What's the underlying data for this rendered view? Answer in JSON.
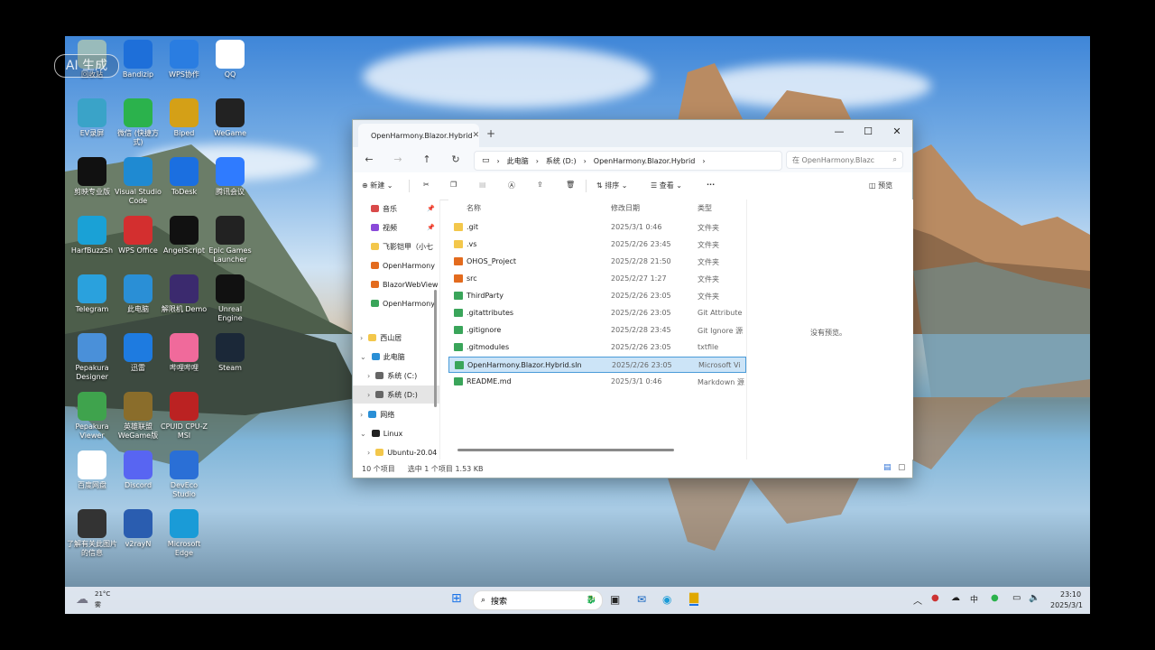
{
  "watermark": "AI 生成",
  "desktop_icons": [
    {
      "label": "回收站",
      "icon": "recycle-bin-icon",
      "color": "#9bb"
    },
    {
      "label": "Bandizip",
      "icon": "bandizip-icon",
      "color": "#1e6fd9"
    },
    {
      "label": "WPS协作",
      "icon": "wps-collab-icon",
      "color": "#2a7de1"
    },
    {
      "label": "QQ",
      "icon": "qq-icon",
      "color": "#fff"
    },
    {
      "label": "EV录屏",
      "icon": "ev-recorder-icon",
      "color": "#3aa3c8"
    },
    {
      "label": "微信 (快捷方式)",
      "icon": "wechat-icon",
      "color": "#2bb24c"
    },
    {
      "label": "Biped",
      "icon": "biped-icon",
      "color": "#d4a017"
    },
    {
      "label": "WeGame",
      "icon": "wegame-icon",
      "color": "#222"
    },
    {
      "label": "剪映专业版",
      "icon": "capcut-icon",
      "color": "#111"
    },
    {
      "label": "Visual Studio Code",
      "icon": "vscode-icon",
      "color": "#1f8ad2"
    },
    {
      "label": "ToDesk",
      "icon": "todesk-icon",
      "color": "#1b6fe0"
    },
    {
      "label": "腾讯会议",
      "icon": "tencent-meeting-icon",
      "color": "#2f7bff"
    },
    {
      "label": "HarfBuzzSh",
      "icon": "edge-dev-icon",
      "color": "#1aa1d6"
    },
    {
      "label": "WPS Office",
      "icon": "wps-office-icon",
      "color": "#d32f2f"
    },
    {
      "label": "AngelScript",
      "icon": "unreal-icon",
      "color": "#111"
    },
    {
      "label": "Epic Games Launcher",
      "icon": "epic-games-icon",
      "color": "#222"
    },
    {
      "label": "Telegram",
      "icon": "telegram-icon",
      "color": "#2aa1dd"
    },
    {
      "label": "此电脑",
      "icon": "this-pc-icon",
      "color": "#2a8fd6"
    },
    {
      "label": "解限机 Demo",
      "icon": "game-demo-icon",
      "color": "#3b2a6e"
    },
    {
      "label": "Unreal Engine",
      "icon": "unreal-engine-icon",
      "color": "#111"
    },
    {
      "label": "Pepakura Designer",
      "icon": "pepakura-designer-icon",
      "color": "#4a90d9"
    },
    {
      "label": "迅雷",
      "icon": "xunlei-icon",
      "color": "#1e7be0"
    },
    {
      "label": "哔哩哔哩",
      "icon": "bilibili-icon",
      "color": "#f06a9b"
    },
    {
      "label": "Steam",
      "icon": "steam-icon",
      "color": "#1b2838"
    },
    {
      "label": "Pepakura Viewer",
      "icon": "pepakura-viewer-icon",
      "color": "#3fa34d"
    },
    {
      "label": "英雄联盟 WeGame版",
      "icon": "lol-icon",
      "color": "#8a6d2b"
    },
    {
      "label": "CPUID CPU-Z MSI",
      "icon": "cpuz-icon",
      "color": "#b22"
    },
    {
      "label": "",
      "icon": "blank-icon",
      "color": "transparent"
    },
    {
      "label": "百度网盘",
      "icon": "baidu-netdisk-icon",
      "color": "#fff"
    },
    {
      "label": "Discord",
      "icon": "discord-icon",
      "color": "#5865f2"
    },
    {
      "label": "DevEco Studio",
      "icon": "deveco-icon",
      "color": "#2a6fd6"
    },
    {
      "label": "",
      "icon": "blank-icon",
      "color": "transparent"
    },
    {
      "label": "了解有关此图片的信息",
      "icon": "spotlight-icon",
      "color": "#333"
    },
    {
      "label": "v2rayN",
      "icon": "v2rayn-icon",
      "color": "#2a5db0"
    },
    {
      "label": "Microsoft Edge",
      "icon": "edge-icon",
      "color": "#1a9bd7"
    }
  ],
  "explorer": {
    "tab_title": "OpenHarmony.Blazor.Hybrid",
    "new_tab": "+",
    "controls": {
      "minimize": "—",
      "maximize": "☐",
      "close": "✕"
    },
    "breadcrumbs": [
      "此电脑",
      "系统 (D:)",
      "OpenHarmony.Blazor.Hybrid"
    ],
    "search_placeholder": "在 OpenHarmony.Blazc",
    "cmd": {
      "new": "新建",
      "sort": "排序",
      "view": "查看",
      "more": "···",
      "preview": "预览"
    },
    "columns": {
      "name": "名称",
      "date": "修改日期",
      "type": "类型"
    },
    "nav": [
      {
        "label": "音乐",
        "color": "#d94a4a",
        "pin": true
      },
      {
        "label": "视频",
        "color": "#8a4ad9",
        "pin": true
      },
      {
        "label": "飞影铠甲（小七",
        "color": "#f3c74b",
        "pin": false
      },
      {
        "label": "OpenHarmony",
        "color": "#e36b1e",
        "pin": false
      },
      {
        "label": "BlazorWebView",
        "color": "#e36b1e",
        "pin": false
      },
      {
        "label": "OpenHarmony",
        "color": "#3aa55a",
        "pin": false
      },
      {
        "label": "西山居",
        "color": "#f3c74b",
        "pin": false
      },
      {
        "label": "此电脑",
        "color": "#2a8fd6",
        "pin": false
      },
      {
        "label": "系统 (C:)",
        "color": "#666",
        "pin": false
      },
      {
        "label": "系统 (D:)",
        "color": "#666",
        "pin": false
      },
      {
        "label": "网络",
        "color": "#2a8fd6",
        "pin": false
      },
      {
        "label": "Linux",
        "color": "#222",
        "pin": false
      },
      {
        "label": "Ubuntu-20.04",
        "color": "#f3c74b",
        "pin": false
      }
    ],
    "files": [
      {
        "name": ".git",
        "date": "2025/3/1 0:46",
        "type": "文件夹",
        "color": "#f3c74b"
      },
      {
        "name": ".vs",
        "date": "2025/2/26 23:45",
        "type": "文件夹",
        "color": "#f3c74b"
      },
      {
        "name": "OHOS_Project",
        "date": "2025/2/28 21:50",
        "type": "文件夹",
        "color": "#e36b1e"
      },
      {
        "name": "src",
        "date": "2025/2/27 1:27",
        "type": "文件夹",
        "color": "#e36b1e"
      },
      {
        "name": "ThirdParty",
        "date": "2025/2/26 23:05",
        "type": "文件夹",
        "color": "#3aa55a"
      },
      {
        "name": ".gitattributes",
        "date": "2025/2/26 23:05",
        "type": "Git Attribute",
        "color": "#3aa55a"
      },
      {
        "name": ".gitignore",
        "date": "2025/2/28 23:45",
        "type": "Git Ignore 源",
        "color": "#3aa55a"
      },
      {
        "name": ".gitmodules",
        "date": "2025/2/26 23:05",
        "type": "txtfile",
        "color": "#3aa55a"
      },
      {
        "name": "OpenHarmony.Blazor.Hybrid.sln",
        "date": "2025/2/26 23:05",
        "type": "Microsoft Vi",
        "color": "#3aa55a"
      },
      {
        "name": "README.md",
        "date": "2025/3/1 0:46",
        "type": "Markdown 源",
        "color": "#3aa55a"
      }
    ],
    "preview_text": "没有预览。",
    "status": {
      "count": "10 个项目",
      "selected": "选中 1 个项目  1.53 KB"
    }
  },
  "taskbar": {
    "weather_temp": "21°C",
    "weather_desc": "雾",
    "search_placeholder": "搜索",
    "ime": "中",
    "time": "23:10",
    "date": "2025/3/1"
  }
}
